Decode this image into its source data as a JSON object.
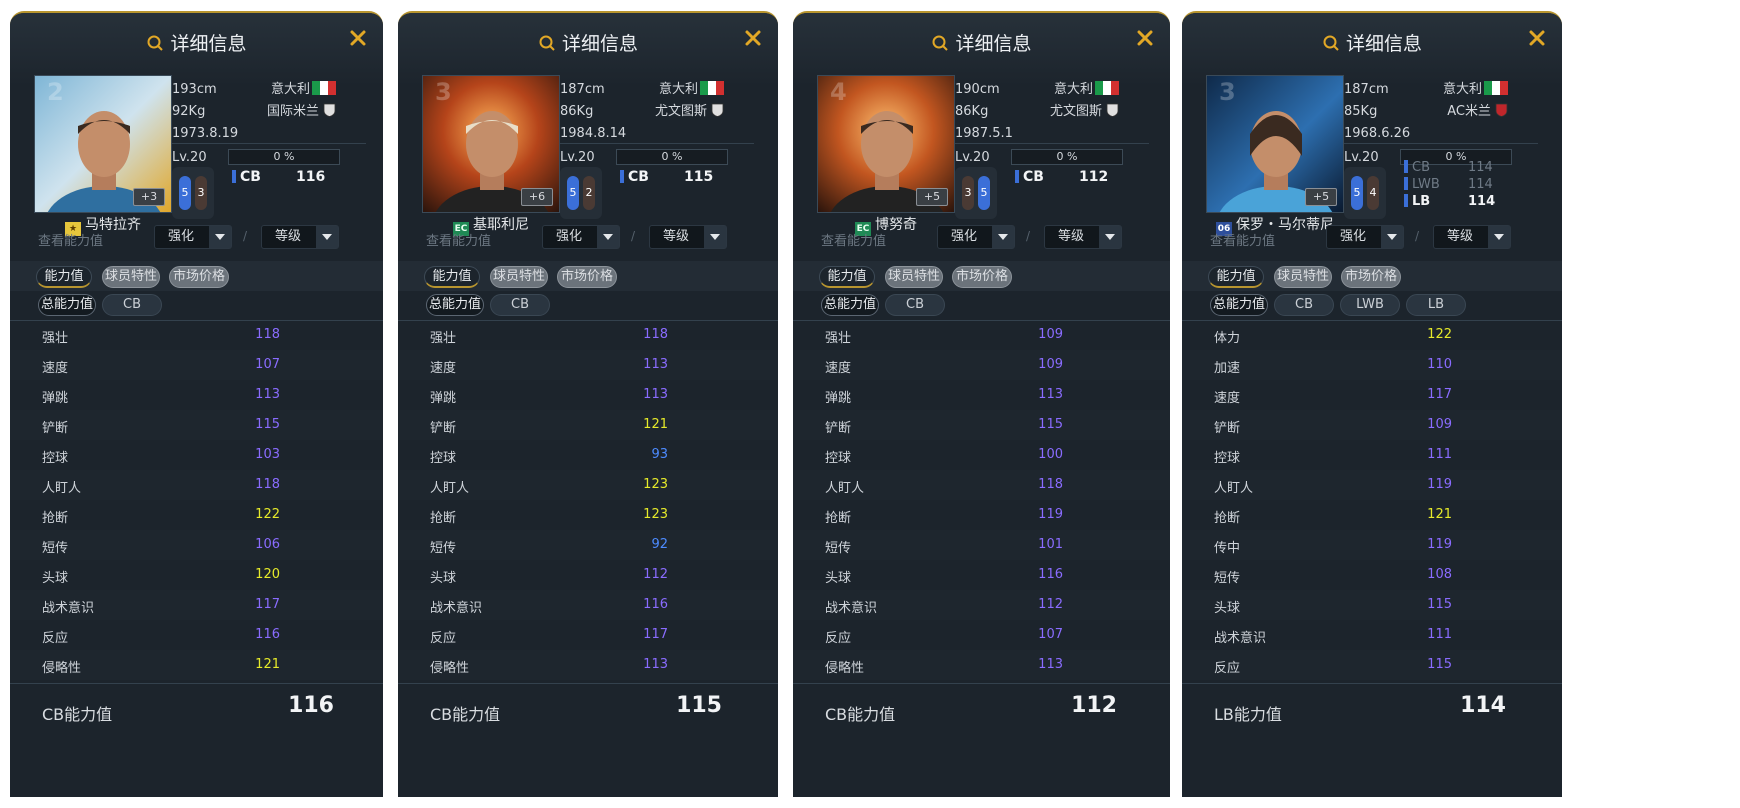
{
  "header": {
    "title": "详细信息"
  },
  "filters": {
    "label": "查看能力值",
    "strengthen": "强化",
    "level": "等级",
    "separator": "/"
  },
  "tabs": {
    "ability": "能力值",
    "traits": "球员特性",
    "market": "市场价格"
  },
  "total_pill": "总能力值",
  "colors": {
    "purple": "#8a6cff",
    "yellow": "#e6ea2a",
    "blue": "#4d8bff",
    "accent": "#b8952f"
  },
  "players": [
    {
      "name": "马特拉齐",
      "badge": "★",
      "shirt": "2",
      "plus": "+3",
      "height": "193cm",
      "weight": "92Kg",
      "birth": "1973.8.19",
      "country": "意大利",
      "club": "国际米兰",
      "level": "Lv.20",
      "progress": "0 %",
      "feet": {
        "left": "5",
        "right": "3"
      },
      "positions": [
        {
          "pos": "CB",
          "value": "116",
          "active": true
        }
      ],
      "pills": [
        "CB"
      ],
      "stats": [
        {
          "label": "强壮",
          "value": "118",
          "color": "purple"
        },
        {
          "label": "速度",
          "value": "107",
          "color": "purple"
        },
        {
          "label": "弹跳",
          "value": "113",
          "color": "purple"
        },
        {
          "label": "铲断",
          "value": "115",
          "color": "purple"
        },
        {
          "label": "控球",
          "value": "103",
          "color": "purple"
        },
        {
          "label": "人盯人",
          "value": "118",
          "color": "purple"
        },
        {
          "label": "抢断",
          "value": "122",
          "color": "yellow"
        },
        {
          "label": "短传",
          "value": "106",
          "color": "purple"
        },
        {
          "label": "头球",
          "value": "120",
          "color": "yellow"
        },
        {
          "label": "战术意识",
          "value": "117",
          "color": "purple"
        },
        {
          "label": "反应",
          "value": "116",
          "color": "purple"
        },
        {
          "label": "侵略性",
          "value": "121",
          "color": "yellow"
        }
      ],
      "footer_label": "CB能力值",
      "footer_value": "116"
    },
    {
      "name": "基耶利尼",
      "badge": "EC",
      "shirt": "3",
      "plus": "+6",
      "height": "187cm",
      "weight": "86Kg",
      "birth": "1984.8.14",
      "country": "意大利",
      "club": "尤文图斯",
      "level": "Lv.20",
      "progress": "0 %",
      "feet": {
        "left": "5",
        "right": "2"
      },
      "positions": [
        {
          "pos": "CB",
          "value": "115",
          "active": true
        }
      ],
      "pills": [
        "CB"
      ],
      "stats": [
        {
          "label": "强壮",
          "value": "118",
          "color": "purple"
        },
        {
          "label": "速度",
          "value": "113",
          "color": "purple"
        },
        {
          "label": "弹跳",
          "value": "113",
          "color": "purple"
        },
        {
          "label": "铲断",
          "value": "121",
          "color": "yellow"
        },
        {
          "label": "控球",
          "value": "93",
          "color": "blue"
        },
        {
          "label": "人盯人",
          "value": "123",
          "color": "yellow"
        },
        {
          "label": "抢断",
          "value": "123",
          "color": "yellow"
        },
        {
          "label": "短传",
          "value": "92",
          "color": "blue"
        },
        {
          "label": "头球",
          "value": "112",
          "color": "purple"
        },
        {
          "label": "战术意识",
          "value": "116",
          "color": "purple"
        },
        {
          "label": "反应",
          "value": "117",
          "color": "purple"
        },
        {
          "label": "侵略性",
          "value": "113",
          "color": "purple"
        }
      ],
      "footer_label": "CB能力值",
      "footer_value": "115"
    },
    {
      "name": "博努奇",
      "badge": "EC",
      "shirt": "4",
      "plus": "+5",
      "height": "190cm",
      "weight": "86Kg",
      "birth": "1987.5.1",
      "country": "意大利",
      "club": "尤文图斯",
      "level": "Lv.20",
      "progress": "0 %",
      "feet": {
        "left": "3",
        "right": "5"
      },
      "positions": [
        {
          "pos": "CB",
          "value": "112",
          "active": true
        }
      ],
      "pills": [
        "CB"
      ],
      "stats": [
        {
          "label": "强壮",
          "value": "109",
          "color": "purple"
        },
        {
          "label": "速度",
          "value": "109",
          "color": "purple"
        },
        {
          "label": "弹跳",
          "value": "113",
          "color": "purple"
        },
        {
          "label": "铲断",
          "value": "115",
          "color": "purple"
        },
        {
          "label": "控球",
          "value": "100",
          "color": "purple"
        },
        {
          "label": "人盯人",
          "value": "118",
          "color": "purple"
        },
        {
          "label": "抢断",
          "value": "119",
          "color": "purple"
        },
        {
          "label": "短传",
          "value": "101",
          "color": "purple"
        },
        {
          "label": "头球",
          "value": "116",
          "color": "purple"
        },
        {
          "label": "战术意识",
          "value": "112",
          "color": "purple"
        },
        {
          "label": "反应",
          "value": "107",
          "color": "purple"
        },
        {
          "label": "侵略性",
          "value": "113",
          "color": "purple"
        }
      ],
      "footer_label": "CB能力值",
      "footer_value": "112"
    },
    {
      "name": "保罗・马尔蒂尼",
      "badge": "06",
      "shirt": "3",
      "plus": "+5",
      "height": "187cm",
      "weight": "85Kg",
      "birth": "1968.6.26",
      "country": "意大利",
      "club": "AC米兰",
      "level": "Lv.20",
      "progress": "0 %",
      "feet": {
        "left": "5",
        "right": "4"
      },
      "positions": [
        {
          "pos": "CB",
          "value": "114",
          "active": false
        },
        {
          "pos": "LWB",
          "value": "114",
          "active": false
        },
        {
          "pos": "LB",
          "value": "114",
          "active": true
        }
      ],
      "pills": [
        "CB",
        "LWB",
        "LB"
      ],
      "stats": [
        {
          "label": "体力",
          "value": "122",
          "color": "yellow"
        },
        {
          "label": "加速",
          "value": "110",
          "color": "purple"
        },
        {
          "label": "速度",
          "value": "117",
          "color": "purple"
        },
        {
          "label": "铲断",
          "value": "109",
          "color": "purple"
        },
        {
          "label": "控球",
          "value": "111",
          "color": "purple"
        },
        {
          "label": "人盯人",
          "value": "119",
          "color": "purple"
        },
        {
          "label": "抢断",
          "value": "121",
          "color": "yellow"
        },
        {
          "label": "传中",
          "value": "119",
          "color": "purple"
        },
        {
          "label": "短传",
          "value": "108",
          "color": "purple"
        },
        {
          "label": "头球",
          "value": "115",
          "color": "purple"
        },
        {
          "label": "战术意识",
          "value": "111",
          "color": "purple"
        },
        {
          "label": "反应",
          "value": "115",
          "color": "purple"
        }
      ],
      "footer_label": "LB能力值",
      "footer_value": "114"
    }
  ]
}
